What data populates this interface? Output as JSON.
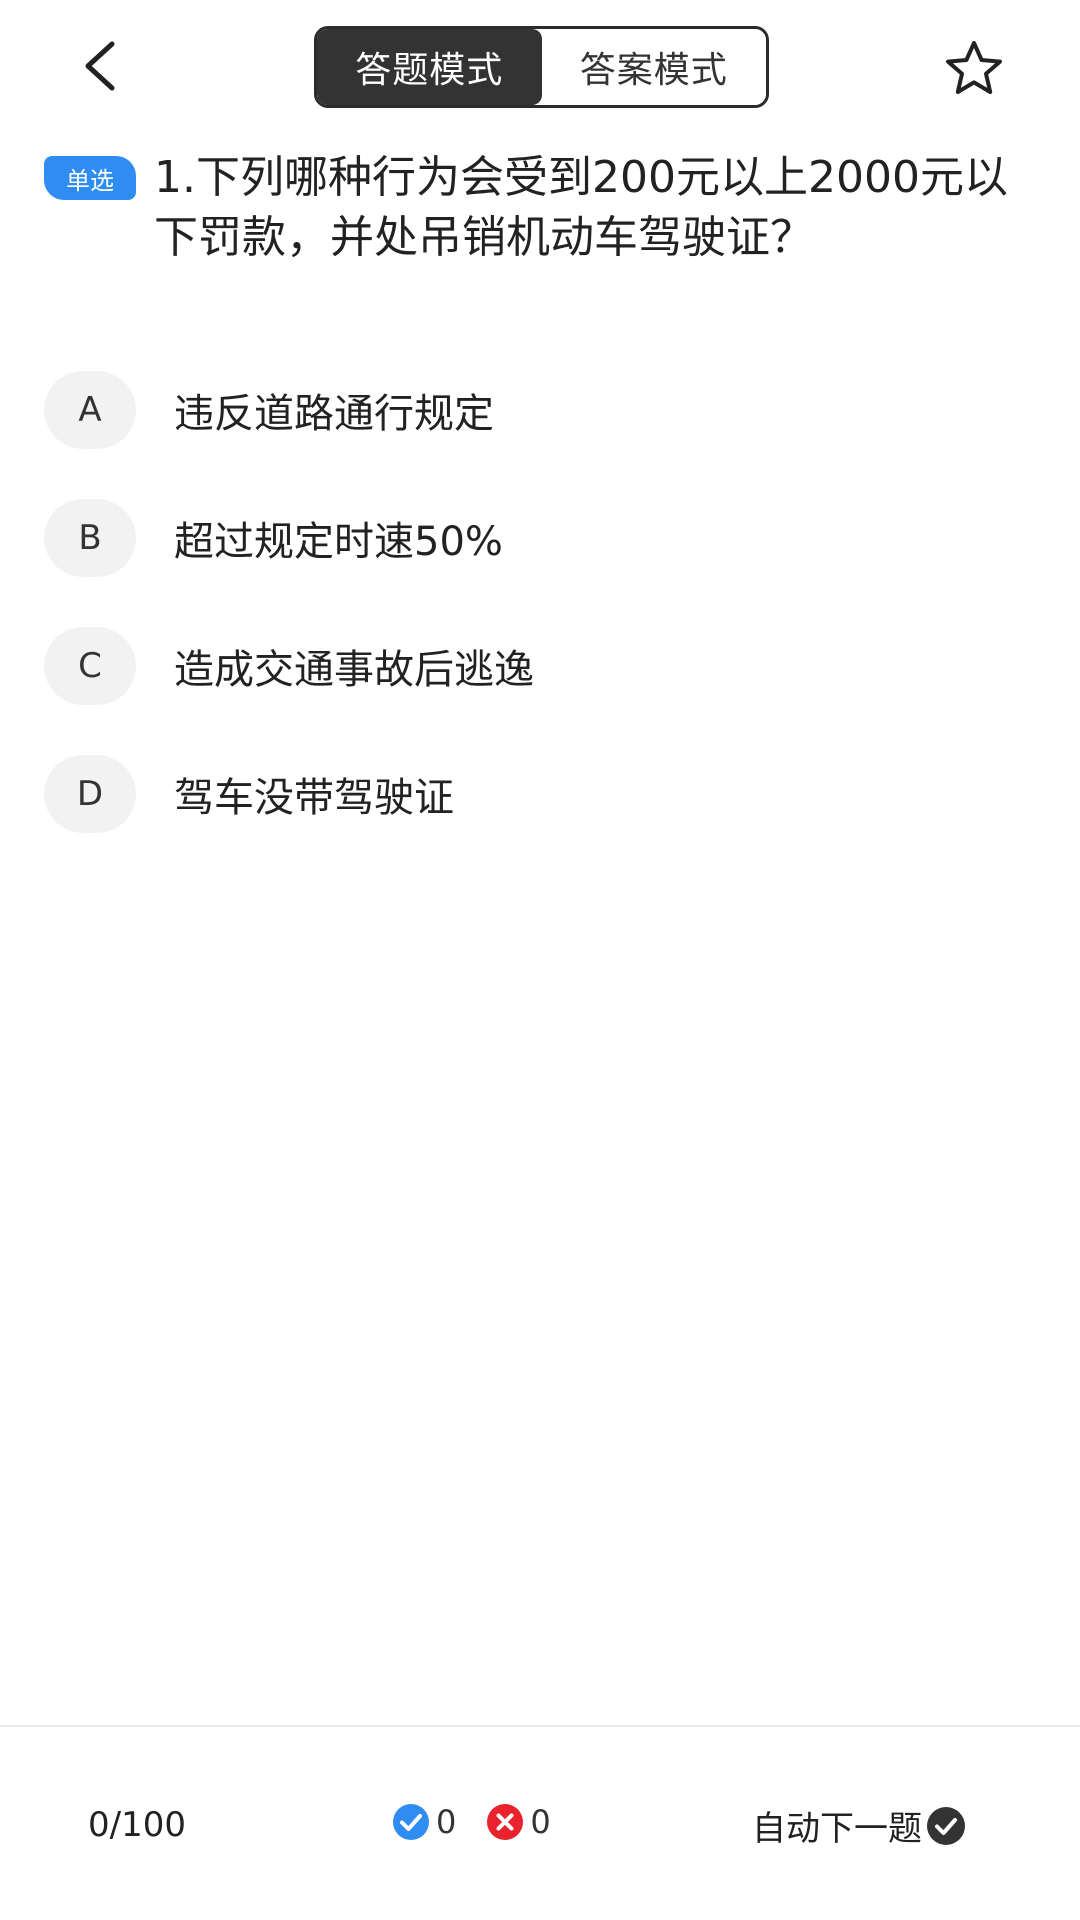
{
  "header": {
    "mode_tabs": [
      {
        "label": "答题模式",
        "active": true
      },
      {
        "label": "答案模式",
        "active": false
      }
    ],
    "back_icon": "chevron-left-icon",
    "favorite_icon": "star-outline-icon"
  },
  "question": {
    "type_badge": "单选",
    "text": "1.下列哪种行为会受到200元以上2000元以下罚款，并处吊销机动车驾驶证？",
    "options": [
      {
        "letter": "A",
        "text": "违反道路通行规定"
      },
      {
        "letter": "B",
        "text": "超过规定时速50%"
      },
      {
        "letter": "C",
        "text": "造成交通事故后逃逸"
      },
      {
        "letter": "D",
        "text": "驾车没带驾驶证"
      }
    ]
  },
  "footer": {
    "progress": "0/100",
    "correct_count": "0",
    "wrong_count": "0",
    "auto_next_label": "自动下一题"
  },
  "colors": {
    "accent_blue": "#2f8cf0",
    "wrong_red": "#e8232e",
    "dark": "#333333"
  }
}
